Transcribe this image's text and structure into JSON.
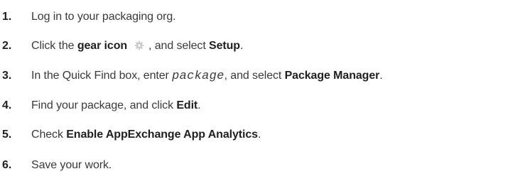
{
  "steps": [
    {
      "number": "1.",
      "text": "Log in to your packaging org."
    },
    {
      "number": "2.",
      "pre": "Click the ",
      "bold1": "gear icon",
      "icon": "gear-icon",
      "mid": ", and select ",
      "bold2": "Setup",
      "post": "."
    },
    {
      "number": "3.",
      "pre": "In the Quick Find box, enter ",
      "code": "package",
      "mid": ", and select ",
      "bold": "Package Manager",
      "post": "."
    },
    {
      "number": "4.",
      "pre": "Find your package, and click ",
      "bold": "Edit",
      "post": "."
    },
    {
      "number": "5.",
      "pre": "Check ",
      "bold": "Enable AppExchange App Analytics",
      "post": "."
    },
    {
      "number": "6.",
      "text": "Save your work."
    }
  ]
}
